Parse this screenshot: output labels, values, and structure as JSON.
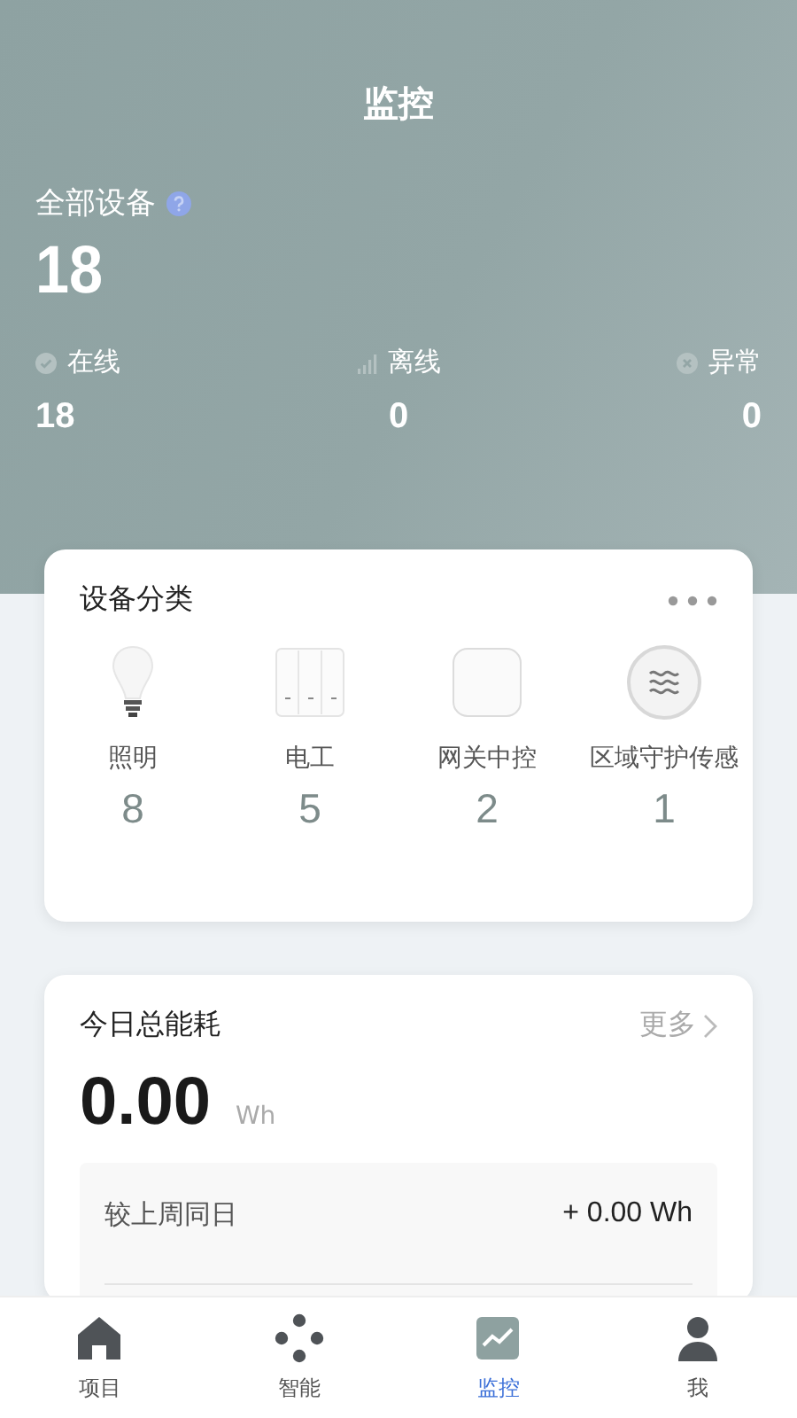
{
  "header": {
    "title": "监控"
  },
  "summary": {
    "label": "全部设备",
    "total": "18",
    "stats": [
      {
        "kind": "online",
        "label": "在线",
        "value": "18"
      },
      {
        "kind": "offline",
        "label": "离线",
        "value": "0"
      },
      {
        "kind": "abnormal",
        "label": "异常",
        "value": "0"
      }
    ]
  },
  "categories": {
    "title": "设备分类",
    "items": [
      {
        "kind": "bulb",
        "label": "照明",
        "count": "8"
      },
      {
        "kind": "switch",
        "label": "电工",
        "count": "5"
      },
      {
        "kind": "gateway",
        "label": "网关中控",
        "count": "2"
      },
      {
        "kind": "sensor",
        "label": "区域守护传感",
        "count": "1"
      }
    ]
  },
  "energy": {
    "title": "今日总能耗",
    "more": "更多",
    "value": "0.00",
    "unit": "Wh",
    "rows": [
      {
        "label": "较上周同日",
        "value": "+ 0.00 Wh"
      }
    ]
  },
  "tabs": [
    {
      "kind": "home",
      "label": "项目",
      "selected": false
    },
    {
      "kind": "dots",
      "label": "智能",
      "selected": false
    },
    {
      "kind": "monitor",
      "label": "监控",
      "selected": true
    },
    {
      "kind": "person",
      "label": "我",
      "selected": false
    }
  ]
}
